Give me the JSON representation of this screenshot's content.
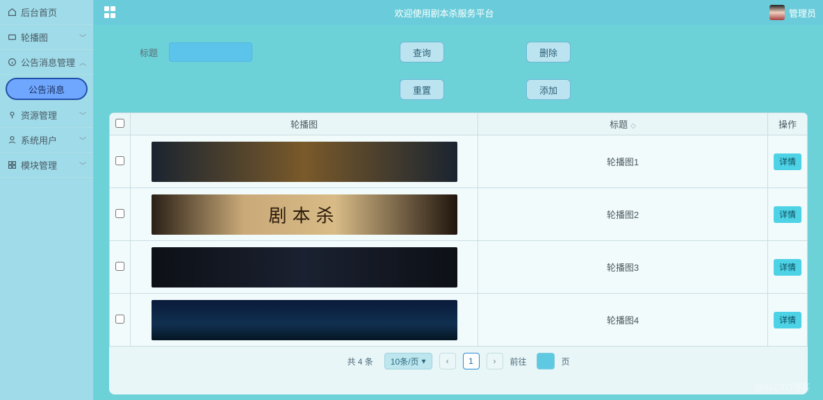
{
  "topbar": {
    "title": "欢迎使用剧本杀服务平台",
    "user_label": "管理员"
  },
  "sidebar": {
    "items": [
      {
        "icon": "home-icon",
        "label": "后台首页",
        "expandable": false
      },
      {
        "icon": "carousel-icon",
        "label": "轮播图",
        "expandable": true
      },
      {
        "icon": "notice-icon",
        "label": "公告消息管理",
        "expandable": true
      },
      {
        "icon": "sub",
        "label": "公告消息",
        "expandable": false,
        "active": true
      },
      {
        "icon": "resource-icon",
        "label": "资源管理",
        "expandable": true
      },
      {
        "icon": "user-icon",
        "label": "系统用户",
        "expandable": true
      },
      {
        "icon": "module-icon",
        "label": "模块管理",
        "expandable": true
      }
    ]
  },
  "filter": {
    "title_label": "标题",
    "title_value": "",
    "query_btn": "查询",
    "delete_btn": "删除",
    "reset_btn": "重置",
    "add_btn": "添加"
  },
  "table": {
    "headers": {
      "image": "轮播图",
      "title": "标题",
      "op": "操作"
    },
    "detail_btn": "详情",
    "rows": [
      {
        "title": "轮播图1",
        "thumb_class": "t1"
      },
      {
        "title": "轮播图2",
        "thumb_class": "t2"
      },
      {
        "title": "轮播图3",
        "thumb_class": "t3"
      },
      {
        "title": "轮播图4",
        "thumb_class": "t4"
      }
    ]
  },
  "pagination": {
    "total_text": "共 4 条",
    "page_size_label": "10条/页",
    "current_page": "1",
    "jump_prefix": "前往",
    "jump_suffix": "页"
  },
  "watermark": "@51CTO博客"
}
